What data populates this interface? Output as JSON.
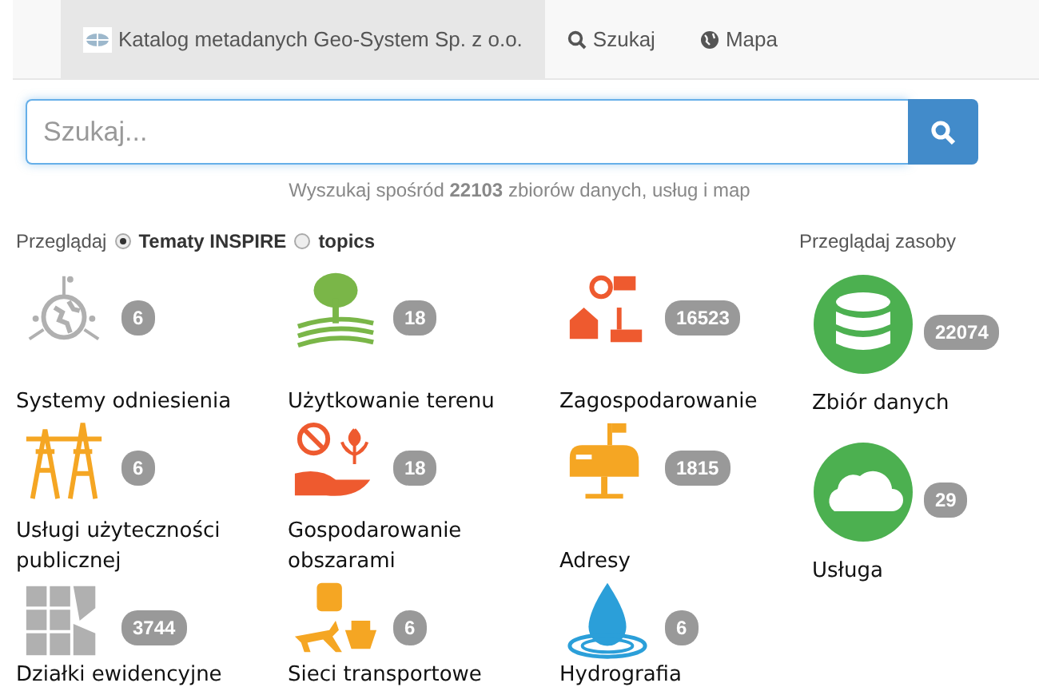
{
  "navbar": {
    "brand": "Katalog metadanych Geo-System Sp. z o.o.",
    "links": [
      {
        "kind": "search",
        "label": "Szukaj"
      },
      {
        "kind": "globe",
        "label": "Mapa"
      }
    ]
  },
  "search": {
    "placeholder": "Szukaj...",
    "help": "Wyszukaj spośród **22103** zbiorów danych, usług i map"
  },
  "browse": {
    "label": "Przeglądaj",
    "options": [
      {
        "label": "Tematy INSPIRE",
        "selected": true
      },
      {
        "label": "topics",
        "selected": false
      }
    ]
  },
  "themes": [
    {
      "kind": "reference",
      "color": "#b0b0b0",
      "count": "6",
      "label": "Systemy odniesienia"
    },
    {
      "kind": "landuse",
      "color": "#7ab648",
      "count": "18",
      "label": "Użytkowanie terenu"
    },
    {
      "kind": "development",
      "color": "#ee5a2f",
      "count": "16523",
      "label": "Zagospodarowanie"
    },
    {
      "kind": "utilities",
      "color": "#f5a623",
      "count": "6",
      "label": "Usługi użyteczności publicznej"
    },
    {
      "kind": "management",
      "color": "#ee5a2f",
      "count": "18",
      "label": "Gospodarowanie obszarami"
    },
    {
      "kind": "addresses",
      "color": "#f5a623",
      "count": "1815",
      "label": "Adresy"
    },
    {
      "kind": "parcels",
      "color": "#b0b0b0",
      "count": "3744",
      "label": "Działki ewidencyjne"
    },
    {
      "kind": "transport",
      "color": "#f5a623",
      "count": "6",
      "label": "Sieci transportowe"
    },
    {
      "kind": "hydro",
      "color": "#2b9fd9",
      "count": "6",
      "label": "Hydrografia"
    }
  ],
  "resources": {
    "title": "Przeglądaj zasoby",
    "items": [
      {
        "kind": "dataset",
        "count": "22074",
        "label": "Zbiór danych"
      },
      {
        "kind": "service",
        "count": "29",
        "label": "Usługa"
      }
    ]
  }
}
